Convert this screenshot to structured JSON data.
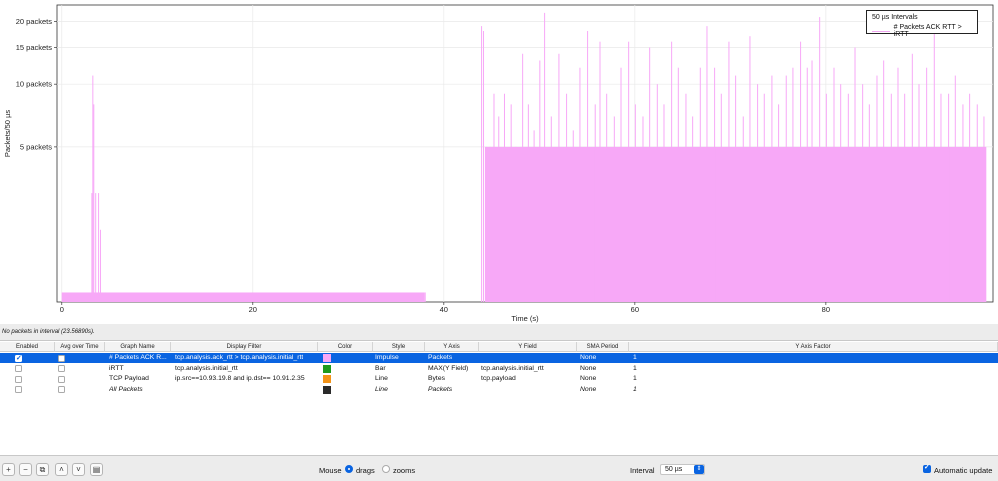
{
  "chart_data": {
    "type": "bar",
    "ylabel": "Packets/50 µs",
    "xlabel": "Time (s)",
    "xlim": [
      -0.5,
      97.5
    ],
    "x_ticks": [
      0,
      20,
      40,
      60,
      80
    ],
    "y_ticks": [
      {
        "value": 5,
        "label": "5 packets"
      },
      {
        "value": 10,
        "label": "10 packets"
      },
      {
        "value": 15,
        "label": "15 packets"
      },
      {
        "value": 20,
        "label": "20 packets"
      }
    ],
    "y_scale": "log",
    "ylim": [
      0.9,
      24
    ],
    "grid": true,
    "legend_title": "50 µs Intervals",
    "legend_position": "top-right",
    "series": [
      {
        "name": "# Packets ACK RTT > iRTT",
        "color": "#f7a8f7",
        "points": [
          [
            0.0,
            1
          ],
          [
            3.1,
            3
          ],
          [
            3.2,
            11
          ],
          [
            3.3,
            8
          ],
          [
            3.5,
            3
          ],
          [
            3.8,
            3
          ],
          [
            4.0,
            2
          ],
          [
            4.5,
            1
          ],
          [
            10,
            1
          ],
          [
            20,
            1
          ],
          [
            30,
            1
          ],
          [
            38,
            1
          ],
          [
            43.9,
            19
          ],
          [
            44.1,
            18
          ],
          [
            44.4,
            5
          ],
          [
            44.8,
            5
          ],
          [
            45.2,
            9
          ],
          [
            45.7,
            7
          ],
          [
            46.3,
            9
          ],
          [
            47.0,
            8
          ],
          [
            47.5,
            5
          ],
          [
            48.2,
            14
          ],
          [
            48.8,
            8
          ],
          [
            49.4,
            6
          ],
          [
            50.0,
            13
          ],
          [
            50.5,
            22
          ],
          [
            51.2,
            7
          ],
          [
            52.0,
            14
          ],
          [
            52.8,
            9
          ],
          [
            53.5,
            6
          ],
          [
            54.2,
            12
          ],
          [
            55.0,
            18
          ],
          [
            55.8,
            8
          ],
          [
            56.3,
            16
          ],
          [
            57.0,
            9
          ],
          [
            57.8,
            7
          ],
          [
            58.5,
            12
          ],
          [
            59.3,
            16
          ],
          [
            60.0,
            8
          ],
          [
            60.8,
            7
          ],
          [
            61.5,
            15
          ],
          [
            62.3,
            10
          ],
          [
            63.0,
            8
          ],
          [
            63.8,
            16
          ],
          [
            64.5,
            12
          ],
          [
            65.3,
            9
          ],
          [
            66.0,
            7
          ],
          [
            66.8,
            12
          ],
          [
            67.5,
            19
          ],
          [
            68.3,
            12
          ],
          [
            69.0,
            9
          ],
          [
            69.8,
            16
          ],
          [
            70.5,
            11
          ],
          [
            71.3,
            7
          ],
          [
            72.0,
            17
          ],
          [
            72.8,
            10
          ],
          [
            73.5,
            9
          ],
          [
            74.3,
            11
          ],
          [
            75.0,
            8
          ],
          [
            75.8,
            11
          ],
          [
            76.5,
            12
          ],
          [
            77.3,
            16
          ],
          [
            78.0,
            12
          ],
          [
            78.5,
            13
          ],
          [
            79.3,
            21
          ],
          [
            80.0,
            9
          ],
          [
            80.8,
            12
          ],
          [
            81.5,
            10
          ],
          [
            82.3,
            9
          ],
          [
            83.0,
            15
          ],
          [
            83.8,
            10
          ],
          [
            84.5,
            8
          ],
          [
            85.3,
            11
          ],
          [
            86.0,
            13
          ],
          [
            86.8,
            9
          ],
          [
            87.5,
            12
          ],
          [
            88.2,
            9
          ],
          [
            89.0,
            14
          ],
          [
            89.7,
            10
          ],
          [
            90.5,
            12
          ],
          [
            91.3,
            22
          ],
          [
            92.0,
            9
          ],
          [
            92.8,
            9
          ],
          [
            93.5,
            11
          ],
          [
            94.3,
            8
          ],
          [
            95.0,
            9
          ],
          [
            95.8,
            8
          ],
          [
            96.5,
            7
          ]
        ]
      }
    ]
  },
  "status_text": "No packets in interval (23.56890s).",
  "table": {
    "headers": [
      "Enabled",
      "Avg over Time",
      "Graph Name",
      "Display Filter",
      "Color",
      "Style",
      "Y Axis",
      "Y Field",
      "SMA Period",
      "Y Axis Factor"
    ],
    "rows": [
      {
        "enabled": true,
        "avg": false,
        "name": "# Packets ACK R...",
        "filter": "tcp.analysis.ack_rtt > tcp.analysis.initial_rtt",
        "color": "#f7a8f7",
        "style": "Impulse",
        "yaxis": "Packets",
        "yfield": "",
        "sma": "None",
        "factor": "1",
        "selected": true,
        "italic": false
      },
      {
        "enabled": false,
        "avg": false,
        "name": "iRTT",
        "filter": "tcp.analysis.initial_rtt",
        "color": "#1e9a1e",
        "style": "Bar",
        "yaxis": "MAX(Y Field)",
        "yfield": "tcp.analysis.initial_rtt",
        "sma": "None",
        "factor": "1",
        "selected": false,
        "italic": false
      },
      {
        "enabled": false,
        "avg": false,
        "name": "TCP Payload",
        "filter": "ip.src==10.93.19.8 and ip.dst== 10.91.2.35",
        "color": "#f29318",
        "style": "Line",
        "yaxis": "Bytes",
        "yfield": "tcp.payload",
        "sma": "None",
        "factor": "1",
        "selected": false,
        "italic": false
      },
      {
        "enabled": false,
        "avg": false,
        "name": "All Packets",
        "filter": "",
        "color": "#2a2a2a",
        "style": "Line",
        "yaxis": "Packets",
        "yfield": "",
        "sma": "None",
        "factor": "1",
        "selected": false,
        "italic": true
      }
    ]
  },
  "toolbar": {
    "buttons": [
      "+",
      "−",
      "⧉",
      "˄",
      "˅",
      "▤"
    ],
    "mouse_label": "Mouse",
    "drags_label": "drags",
    "zooms_label": "zooms",
    "mouse_mode": "drags",
    "interval_label": "Interval",
    "interval_value": "50 µs",
    "auto_update_label": "Automatic update",
    "auto_update": true
  }
}
